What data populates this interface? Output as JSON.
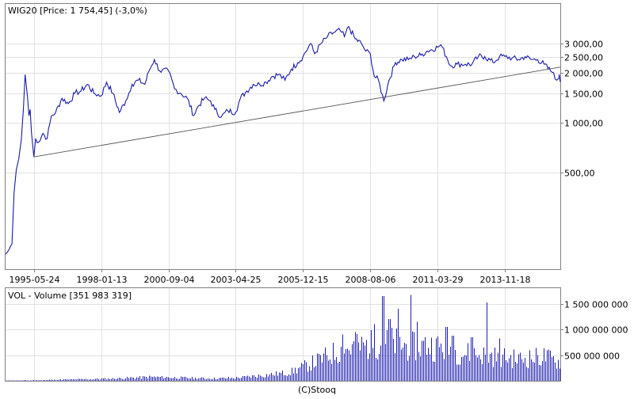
{
  "copyright": "(C)Stooq",
  "chart_data": [
    {
      "type": "line",
      "title": "WIG20 [Price: 1 754,45] (-3,0%)",
      "y_scale": "log",
      "ylim": [
        130,
        5200
      ],
      "x_date_range": [
        "1994-04-14",
        "2016-01-20"
      ],
      "x_ticks": [
        "1995-05-24",
        "1998-01-13",
        "2000-09-04",
        "2003-04-25",
        "2005-12-15",
        "2008-08-06",
        "2011-03-29",
        "2013-11-18"
      ],
      "y_ticks": [
        {
          "value": 3000,
          "label": "3 000,00"
        },
        {
          "value": 2500,
          "label": "2 500,00"
        },
        {
          "value": 2000,
          "label": "2 000,00"
        },
        {
          "value": 1500,
          "label": "1 500,00"
        },
        {
          "value": 1000,
          "label": "1 000,00"
        },
        {
          "value": 500,
          "label": "500,00"
        }
      ],
      "grid": true,
      "series": [
        {
          "color": "#1a1aa6",
          "points": [
            [
              "1994-04-16",
              160
            ],
            [
              "1994-06-01",
              170
            ],
            [
              "1994-07-15",
              185
            ],
            [
              "1994-08-15",
              380
            ],
            [
              "1994-09-15",
              520
            ],
            [
              "1994-10-20",
              600
            ],
            [
              "1994-11-25",
              780
            ],
            [
              "1994-12-25",
              1200
            ],
            [
              "1995-01-20",
              1950
            ],
            [
              "1995-02-25",
              1400
            ],
            [
              "1995-03-15",
              1100
            ],
            [
              "1995-04-01",
              1200
            ],
            [
              "1995-04-20",
              870
            ],
            [
              "1995-05-24",
              620
            ],
            [
              "1995-06-20",
              800
            ],
            [
              "1995-08-01",
              760
            ],
            [
              "1995-10-01",
              860
            ],
            [
              "1995-12-01",
              800
            ],
            [
              "1996-02-01",
              1100
            ],
            [
              "1996-04-01",
              1150
            ],
            [
              "1996-07-01",
              1400
            ],
            [
              "1996-10-01",
              1300
            ],
            [
              "1997-01-01",
              1500
            ],
            [
              "1997-04-01",
              1550
            ],
            [
              "1997-07-01",
              1700
            ],
            [
              "1997-10-01",
              1500
            ],
            [
              "1998-01-13",
              1450
            ],
            [
              "1998-04-01",
              1750
            ],
            [
              "1998-07-01",
              1500
            ],
            [
              "1998-10-01",
              1150
            ],
            [
              "1999-01-01",
              1350
            ],
            [
              "1999-04-01",
              1700
            ],
            [
              "1999-07-01",
              1800
            ],
            [
              "1999-10-01",
              1700
            ],
            [
              "1999-12-01",
              2050
            ],
            [
              "2000-02-15",
              2400
            ],
            [
              "2000-05-01",
              2050
            ],
            [
              "2000-09-04",
              2050
            ],
            [
              "2000-12-01",
              1600
            ],
            [
              "2001-03-01",
              1500
            ],
            [
              "2001-06-01",
              1400
            ],
            [
              "2001-09-01",
              1100
            ],
            [
              "2001-11-01",
              1250
            ],
            [
              "2002-02-01",
              1400
            ],
            [
              "2002-05-01",
              1350
            ],
            [
              "2002-07-01",
              1200
            ],
            [
              "2002-10-01",
              1080
            ],
            [
              "2003-01-01",
              1180
            ],
            [
              "2003-04-25",
              1150
            ],
            [
              "2003-07-01",
              1400
            ],
            [
              "2003-10-01",
              1550
            ],
            [
              "2004-01-01",
              1700
            ],
            [
              "2004-04-01",
              1700
            ],
            [
              "2004-07-01",
              1750
            ],
            [
              "2004-10-01",
              1900
            ],
            [
              "2005-01-01",
              1950
            ],
            [
              "2005-04-01",
              1800
            ],
            [
              "2005-07-01",
              2100
            ],
            [
              "2005-10-01",
              2300
            ],
            [
              "2005-12-15",
              2500
            ],
            [
              "2006-04-01",
              3000
            ],
            [
              "2006-06-01",
              2600
            ],
            [
              "2006-09-01",
              3000
            ],
            [
              "2006-12-01",
              3300
            ],
            [
              "2007-03-01",
              3500
            ],
            [
              "2007-06-01",
              3600
            ],
            [
              "2007-08-01",
              3300
            ],
            [
              "2007-10-01",
              3800
            ],
            [
              "2008-01-01",
              3200
            ],
            [
              "2008-04-01",
              3000
            ],
            [
              "2008-06-01",
              2700
            ],
            [
              "2008-08-06",
              2600
            ],
            [
              "2008-10-01",
              1900
            ],
            [
              "2008-12-01",
              1800
            ],
            [
              "2009-02-15",
              1350
            ],
            [
              "2009-05-01",
              1800
            ],
            [
              "2009-08-01",
              2300
            ],
            [
              "2009-11-01",
              2400
            ],
            [
              "2010-02-01",
              2400
            ],
            [
              "2010-05-01",
              2500
            ],
            [
              "2010-08-01",
              2550
            ],
            [
              "2010-11-01",
              2700
            ],
            [
              "2011-03-29",
              2850
            ],
            [
              "2011-05-15",
              2950
            ],
            [
              "2011-08-01",
              2500
            ],
            [
              "2011-10-01",
              2200
            ],
            [
              "2012-01-01",
              2250
            ],
            [
              "2012-05-01",
              2250
            ],
            [
              "2012-08-01",
              2250
            ],
            [
              "2012-11-01",
              2500
            ],
            [
              "2013-02-01",
              2500
            ],
            [
              "2013-06-01",
              2300
            ],
            [
              "2013-09-01",
              2500
            ],
            [
              "2013-11-18",
              2500
            ],
            [
              "2014-03-01",
              2450
            ],
            [
              "2014-06-01",
              2400
            ],
            [
              "2014-09-01",
              2500
            ],
            [
              "2014-12-01",
              2400
            ],
            [
              "2015-03-01",
              2400
            ],
            [
              "2015-06-01",
              2250
            ],
            [
              "2015-09-01",
              2050
            ],
            [
              "2015-10-15",
              2000
            ],
            [
              "2015-12-01",
              1800
            ],
            [
              "2015-12-31",
              1850
            ],
            [
              "2016-01-05",
              1950
            ],
            [
              "2016-01-15",
              1800
            ],
            [
              "2016-01-20",
              1754
            ]
          ]
        }
      ],
      "trendline": {
        "color": "#555555",
        "from": [
          "1995-05-24",
          620
        ],
        "to": [
          "2016-06-15",
          2160
        ]
      }
    },
    {
      "type": "bar",
      "title": "VOL - Volume [351 983 319]",
      "ylim": [
        0,
        1800000000
      ],
      "y_ticks": [
        {
          "value": 500000000,
          "label": "500 000 000"
        },
        {
          "value": 1000000000,
          "label": "1 000 000 000"
        },
        {
          "value": 1500000000,
          "label": "1 500 000 000"
        }
      ],
      "grid": true,
      "bar_color": "#1f1fb0",
      "volume_knots": [
        [
          "1994-04-01",
          6000000
        ],
        [
          "1995-06-01",
          12000000
        ],
        [
          "1997-01-01",
          28000000
        ],
        [
          "1998-06-01",
          40000000
        ],
        [
          "2000-01-01",
          75000000
        ],
        [
          "2001-06-01",
          55000000
        ],
        [
          "2002-06-01",
          45000000
        ],
        [
          "2003-06-01",
          60000000
        ],
        [
          "2004-06-01",
          110000000
        ],
        [
          "2005-06-01",
          160000000
        ],
        [
          "2006-01-01",
          280000000
        ],
        [
          "2006-09-01",
          420000000
        ],
        [
          "2007-03-01",
          540000000
        ],
        [
          "2007-09-01",
          620000000
        ],
        [
          "2008-06-01",
          680000000
        ],
        [
          "2009-06-01",
          740000000
        ],
        [
          "2010-03-01",
          660000000
        ],
        [
          "2010-11-01",
          690000000
        ],
        [
          "2011-06-01",
          640000000
        ],
        [
          "2012-03-01",
          540000000
        ],
        [
          "2013-06-01",
          480000000
        ],
        [
          "2014-06-01",
          420000000
        ],
        [
          "2015-06-01",
          470000000
        ],
        [
          "2016-01-20",
          352000000
        ]
      ],
      "volume_spikes": [
        [
          "2009-02-01",
          1650000000
        ],
        [
          "2010-03-01",
          1670000000
        ],
        [
          "2009-09-01",
          1400000000
        ],
        [
          "2013-03-01",
          1520000000
        ],
        [
          "2009-05-01",
          1200000000
        ],
        [
          "2008-10-01",
          1100000000
        ],
        [
          "2010-06-01",
          1150000000
        ],
        [
          "2011-08-01",
          1050000000
        ],
        [
          "2008-01-01",
          950000000
        ],
        [
          "2011-11-01",
          880000000
        ],
        [
          "2012-08-01",
          850000000
        ],
        [
          "2013-09-01",
          820000000
        ],
        [
          "2007-07-01",
          900000000
        ]
      ]
    }
  ]
}
